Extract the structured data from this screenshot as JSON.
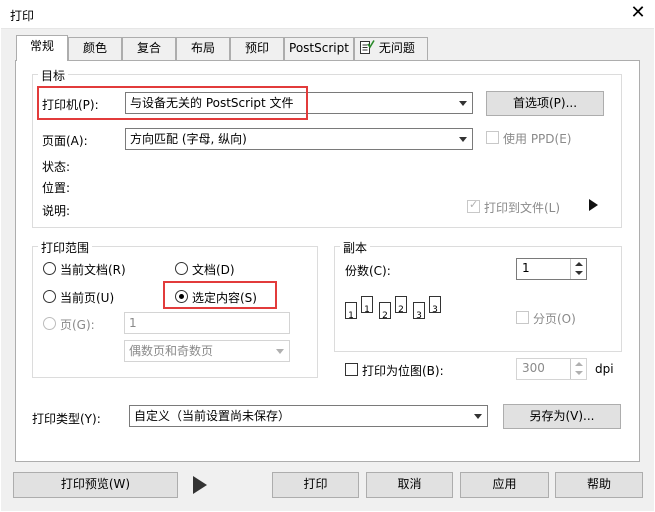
{
  "window": {
    "title": "打印"
  },
  "tabs": [
    {
      "label": "常规"
    },
    {
      "label": "颜色"
    },
    {
      "label": "复合"
    },
    {
      "label": "布局"
    },
    {
      "label": "预印"
    },
    {
      "label": "PostScript"
    },
    {
      "label": "无问题"
    }
  ],
  "target": {
    "legend": "目标",
    "printer_label": "打印机(P):",
    "printer_value": "与设备无关的 PostScript 文件",
    "preferences_button": "首选项(P)...",
    "page_label": "页面(A):",
    "page_value": "方向匹配 (字母, 纵向)",
    "use_ppd": "使用 PPD(E)",
    "status_label": "状态:",
    "location_label": "位置:",
    "comment_label": "说明:",
    "print_to_file": "打印到文件(L)"
  },
  "range": {
    "legend": "打印范围",
    "current_document": "当前文档(R)",
    "documents": "文档(D)",
    "current_page": "当前页(U)",
    "selection": "选定内容(S)",
    "pages": "页(G):",
    "pages_value": "1",
    "page_set": "偶数页和奇数页"
  },
  "copies": {
    "legend": "副本",
    "count_label": "份数(C):",
    "count_value": "1",
    "collate": "分页(O)",
    "page_numbers": [
      "1",
      "1",
      "2",
      "2",
      "3",
      "3"
    ]
  },
  "bitmap": {
    "label": "打印为位图(B):",
    "value": "300",
    "unit": "dpi"
  },
  "print_type": {
    "label": "打印类型(Y):",
    "value": "自定义（当前设置尚未保存）",
    "save_as": "另存为(V)..."
  },
  "footer": {
    "preview": "打印预览(W)",
    "print": "打印",
    "cancel": "取消",
    "apply": "应用",
    "help": "帮助"
  }
}
